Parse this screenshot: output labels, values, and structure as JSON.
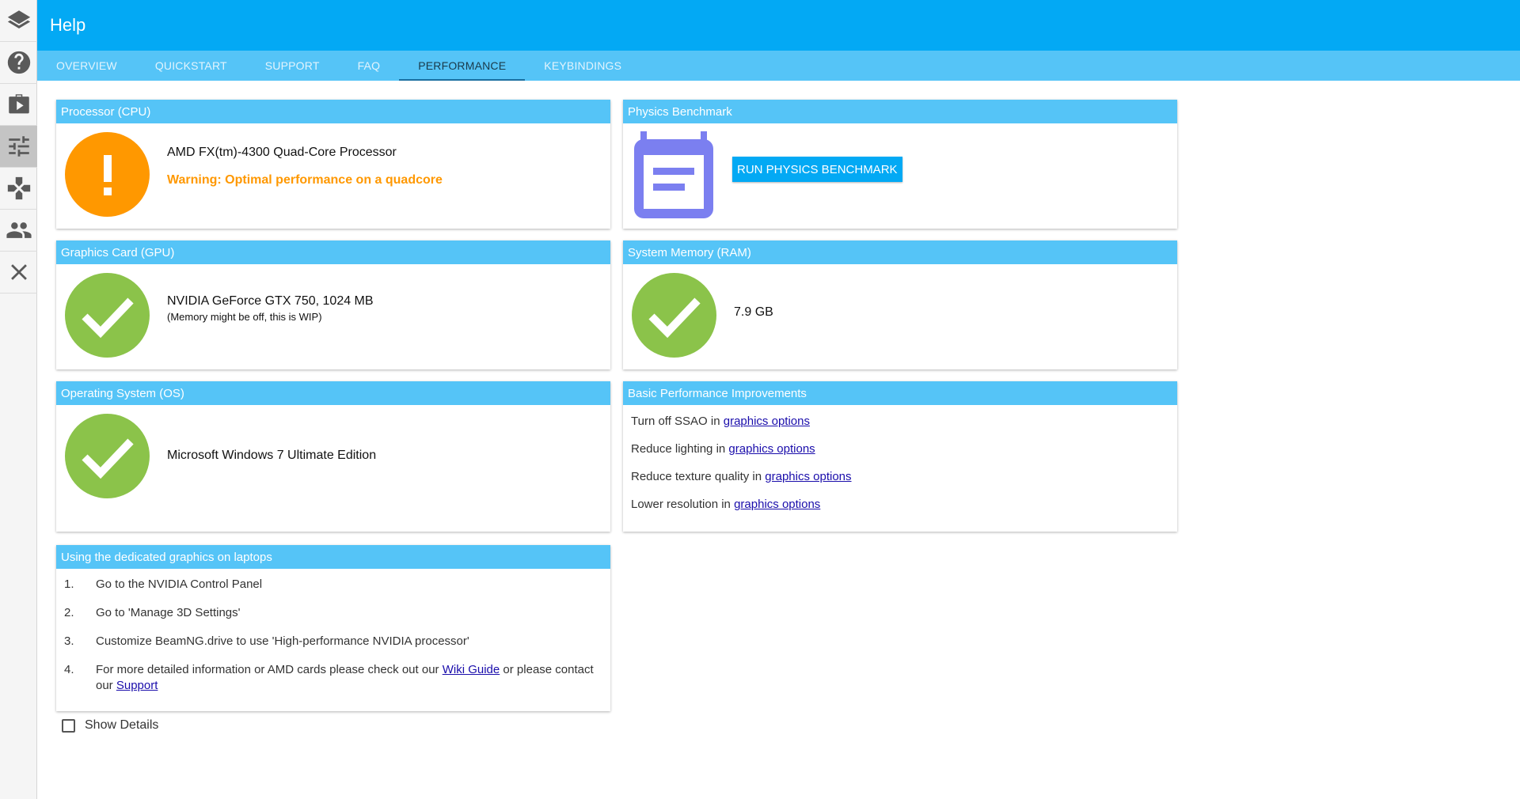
{
  "app": {
    "title": "Help"
  },
  "sidebar": {
    "items": [
      {
        "icon": "layers-icon"
      },
      {
        "icon": "help-icon"
      },
      {
        "icon": "briefcase-play-icon"
      },
      {
        "icon": "sliders-icon",
        "active": true
      },
      {
        "icon": "gamepad-icon"
      },
      {
        "icon": "people-icon"
      },
      {
        "icon": "close-icon"
      }
    ]
  },
  "tabs": [
    {
      "label": "OVERVIEW"
    },
    {
      "label": "QUICKSTART"
    },
    {
      "label": "SUPPORT"
    },
    {
      "label": "FAQ"
    },
    {
      "label": "PERFORMANCE",
      "active": true
    },
    {
      "label": "KEYBINDINGS"
    }
  ],
  "cpu": {
    "header": "Processor (CPU)",
    "name": "AMD FX(tm)-4300 Quad-Core Processor",
    "warning": "Warning: Optimal performance on a quadcore",
    "status": "warning"
  },
  "physics": {
    "header": "Physics Benchmark",
    "button": "RUN PHYSICS BENCHMARK"
  },
  "gpu": {
    "header": "Graphics Card (GPU)",
    "name": "NVIDIA GeForce GTX 750, 1024 MB",
    "note": "(Memory might be off, this is WIP)",
    "status": "ok"
  },
  "ram": {
    "header": "System Memory (RAM)",
    "value": "7.9 GB",
    "status": "ok"
  },
  "os": {
    "header": "Operating System (OS)",
    "name": "Microsoft Windows 7 Ultimate Edition",
    "status": "ok"
  },
  "improvements": {
    "header": "Basic Performance Improvements",
    "link_text": "graphics options",
    "items": [
      "Turn off SSAO in",
      "Reduce lighting in",
      "Reduce texture quality in",
      "Lower resolution in"
    ]
  },
  "laptop": {
    "header": "Using the dedicated graphics on laptops",
    "steps": [
      {
        "num": "1.",
        "text": "Go to the NVIDIA Control Panel"
      },
      {
        "num": "2.",
        "text": "Go to 'Manage 3D Settings'"
      },
      {
        "num": "3.",
        "text": "Customize BeamNG.drive to use 'High-performance NVIDIA processor'"
      }
    ],
    "step4": {
      "num": "4.",
      "text_a": "For more detailed information or AMD cards please check out our",
      "link_a": "Wiki Guide",
      "text_b": "or please contact our",
      "link_b": "Support"
    }
  },
  "details": {
    "label": "Show Details",
    "checked": false
  },
  "colors": {
    "primary": "#03a9f4",
    "header_light": "#55c4f7",
    "ok": "#8bc34a",
    "warning": "#ff9800",
    "bench_icon": "#7b7ff0"
  }
}
